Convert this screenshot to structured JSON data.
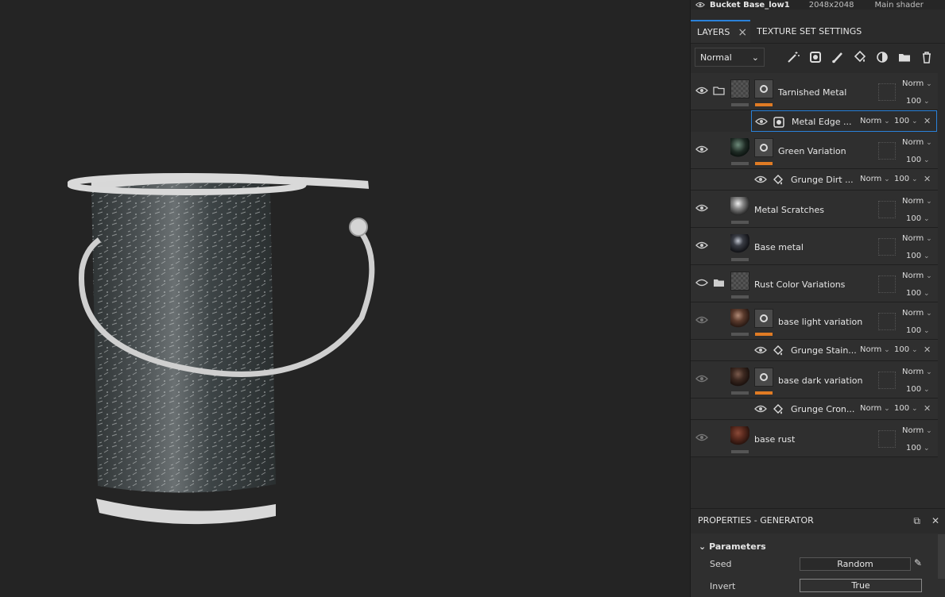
{
  "texture_set": {
    "name": "Bucket Base_low1",
    "resolution": "2048x2048",
    "shader": "Main shader"
  },
  "tabs": [
    {
      "label": "LAYERS"
    },
    {
      "label": "TEXTURE SET SETTINGS"
    }
  ],
  "toolbar": {
    "blend_mode": "Normal",
    "tools": [
      "magic-wand-icon",
      "add-fill-icon",
      "paint-brush-icon",
      "fill-bucket-icon",
      "smart-material-icon",
      "folder-icon",
      "trash-icon"
    ]
  },
  "layers": [
    {
      "name": "Tarnished Metal",
      "blend": "Norm",
      "opacity": "100",
      "folder": true,
      "mask": true,
      "eye": "on",
      "sub": [
        {
          "name": "Metal Edge ...",
          "blend": "Norm",
          "opacity": "100",
          "selected": true
        }
      ]
    },
    {
      "name": "Green Variation",
      "blend": "Norm",
      "opacity": "100",
      "mask": true,
      "eye": "on",
      "sub": [
        {
          "name": "Grunge Dirt ...",
          "blend": "Norm",
          "opacity": "100"
        }
      ]
    },
    {
      "name": "Metal Scratches",
      "blend": "Norm",
      "opacity": "100",
      "eye": "on"
    },
    {
      "name": "Base metal",
      "blend": "Norm",
      "opacity": "100",
      "eye": "on"
    },
    {
      "name": "Rust Color Variations",
      "blend": "Norm",
      "opacity": "100",
      "folder": true,
      "eye": "off"
    },
    {
      "name": "base light variation",
      "blend": "Norm",
      "opacity": "100",
      "mask": true,
      "eye": "dim",
      "sub": [
        {
          "name": "Grunge Stain...",
          "blend": "Norm",
          "opacity": "100"
        }
      ]
    },
    {
      "name": "base dark variation",
      "blend": "Norm",
      "opacity": "100",
      "mask": true,
      "eye": "dim",
      "sub": [
        {
          "name": "Grunge Cron...",
          "blend": "Norm",
          "opacity": "100"
        }
      ]
    },
    {
      "name": "base rust",
      "blend": "Norm",
      "opacity": "100",
      "eye": "dim"
    }
  ],
  "properties": {
    "title": "PROPERTIES - GENERATOR",
    "section": "Parameters",
    "seed_label": "Seed",
    "seed_value": "Random",
    "invert_label": "Invert",
    "invert_value": "True"
  },
  "colors": {
    "accent": "#2a82da",
    "mask_bar": "#e07b24"
  }
}
